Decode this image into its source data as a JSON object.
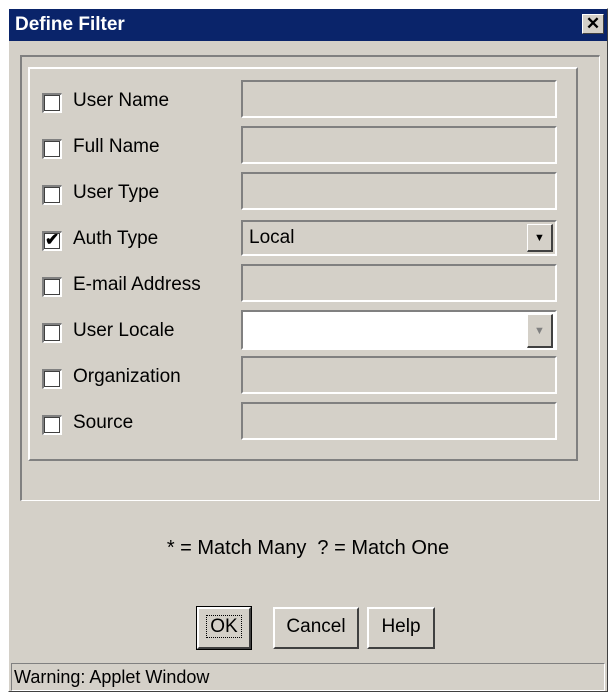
{
  "window": {
    "title": "Define Filter",
    "close_glyph": "✕"
  },
  "filters": [
    {
      "label": "User Name",
      "checked": false,
      "control": "text",
      "value": ""
    },
    {
      "label": "Full Name",
      "checked": false,
      "control": "text",
      "value": ""
    },
    {
      "label": "User Type",
      "checked": false,
      "control": "text",
      "value": ""
    },
    {
      "label": "Auth Type",
      "checked": true,
      "control": "select",
      "value": "Local"
    },
    {
      "label": "E-mail Address",
      "checked": false,
      "control": "text",
      "value": ""
    },
    {
      "label": "User Locale",
      "checked": false,
      "control": "select",
      "value": ""
    },
    {
      "label": "Organization",
      "checked": false,
      "control": "text",
      "value": ""
    },
    {
      "label": "Source",
      "checked": false,
      "control": "text",
      "value": ""
    }
  ],
  "hint": "* = Match Many  ? = Match One",
  "buttons": {
    "ok": "OK",
    "cancel": "Cancel",
    "help": "Help"
  },
  "status": "Warning: Applet Window",
  "icons": {
    "check": "✔",
    "dropdown": "▼"
  },
  "colors": {
    "titlebar": "#0a246a",
    "dialog_bg": "#d4d0c8"
  }
}
